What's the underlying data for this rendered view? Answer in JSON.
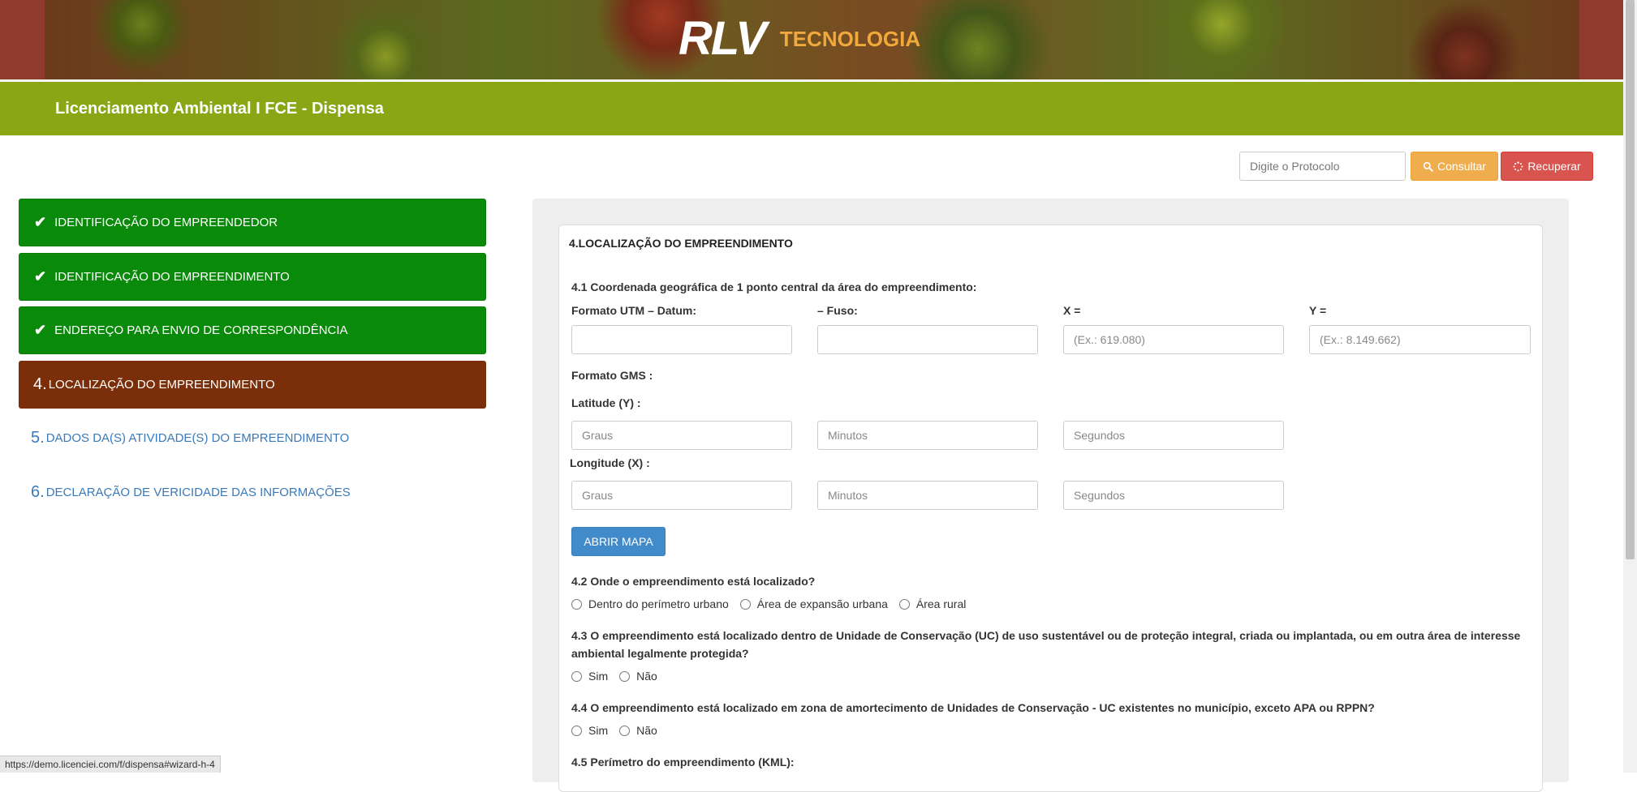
{
  "header": {
    "logo_mark": "RLV",
    "logo_sub": "TECNOLOGIA",
    "title": "Licenciamento Ambiental I FCE - Dispensa"
  },
  "search": {
    "placeholder": "Digite o Protocolo",
    "consultar_label": "Consultar",
    "recuperar_label": "Recuperar"
  },
  "steps": [
    {
      "num": "",
      "label": "IDENTIFICAÇÃO DO EMPREENDEDOR",
      "state": "done"
    },
    {
      "num": "",
      "label": "IDENTIFICAÇÃO DO EMPREENDIMENTO",
      "state": "done"
    },
    {
      "num": "",
      "label": "ENDEREÇO PARA ENVIO DE CORRESPONDÊNCIA",
      "state": "done"
    },
    {
      "num": "4.",
      "label": "LOCALIZAÇÃO DO EMPREENDIMENTO",
      "state": "current"
    },
    {
      "num": "5.",
      "label": "DADOS DA(S) ATIVIDADE(S) DO EMPREENDIMENTO",
      "state": "todo"
    },
    {
      "num": "6.",
      "label": "DECLARAÇÃO DE VERICIDADE DAS INFORMAÇÕES",
      "state": "todo"
    }
  ],
  "form": {
    "section_title": "4.LOCALIZAÇÃO DO EMPREENDIMENTO",
    "q41": "4.1 Coordenada geográfica de 1 ponto central da área do empreendimento:",
    "utm_label": "Formato UTM – Datum:",
    "fuso_label": "– Fuso:",
    "x_label": "X =",
    "y_label": "Y =",
    "x_placeholder": "(Ex.: 619.080)",
    "y_placeholder": "(Ex.: 8.149.662)",
    "gms_label": "Formato GMS :",
    "lat_label": "Latitude (Y) :",
    "lon_label": "Longitude (X) :",
    "graus_placeholder": "Graus",
    "minutos_placeholder": "Minutos",
    "segundos_placeholder": "Segundos",
    "mapa_button": "ABRIR MAPA",
    "q42": "4.2 Onde o empreendimento está localizado?",
    "q42_options": [
      "Dentro do perímetro urbano",
      "Área de expansão urbana",
      "Área rural"
    ],
    "q43": "4.3 O empreendimento está localizado dentro de Unidade de Conservação (UC) de uso sustentável ou de proteção integral, criada ou implantada, ou em outra área de interesse ambiental legalmente protegida?",
    "q43_options": [
      "Sim",
      "Não"
    ],
    "q44": "4.4 O empreendimento está localizado em zona de amortecimento de Unidades de Conservação - UC existentes no município, exceto APA ou RPPN?",
    "q44_options": [
      "Sim",
      "Não"
    ],
    "q45": "4.5 Perímetro do empreendimento (KML):"
  },
  "statusbar": {
    "url": "https://demo.licenciei.com/f/dispensa#wizard-h-4"
  }
}
